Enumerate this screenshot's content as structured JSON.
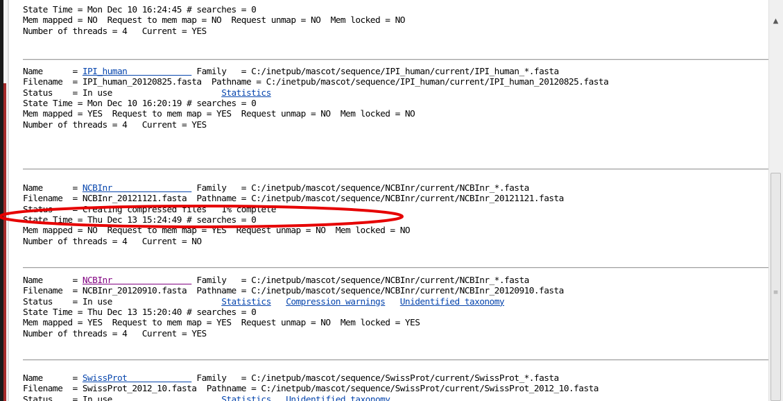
{
  "blocks": [
    {
      "id": "top",
      "lines": [
        [
          {
            "t": "State Time = Mon Dec 10 16:24:45 # searches = 0"
          }
        ],
        [
          {
            "t": "Mem mapped = NO  Request to mem map = NO  Request unmap = NO  Mem locked = NO"
          }
        ],
        [
          {
            "t": "Number of threads = 4   Current = YES"
          }
        ]
      ]
    },
    {
      "id": "ipi-human",
      "lines": [
        [
          {
            "t": "Name      = "
          },
          {
            "t": "IPI_human             ",
            "link": "link"
          },
          {
            "t": " Family   = C:/inetpub/mascot/sequence/IPI_human/current/IPI_human_*.fasta"
          }
        ],
        [
          {
            "t": "Filename  = IPI_human_20120825.fasta  Pathname = C:/inetpub/mascot/sequence/IPI_human/current/IPI_human_20120825.fasta"
          }
        ],
        [
          {
            "t": "Status    = In use                      "
          },
          {
            "t": "Statistics",
            "link": "link"
          }
        ],
        [
          {
            "t": "State Time = Mon Dec 10 16:20:19 # searches = 0"
          }
        ],
        [
          {
            "t": "Mem mapped = YES  Request to mem map = YES  Request unmap = NO  Mem locked = NO"
          }
        ],
        [
          {
            "t": "Number of threads = 4   Current = YES"
          }
        ]
      ]
    },
    {
      "id": "ncbinr-new",
      "lines": [
        [
          {
            "t": "Name      = "
          },
          {
            "t": "NCBInr                ",
            "link": "link"
          },
          {
            "t": " Family   = C:/inetpub/mascot/sequence/NCBInr/current/NCBInr_*.fasta"
          }
        ],
        [
          {
            "t": "Filename  = NCBInr_20121121.fasta  Pathname = C:/inetpub/mascot/sequence/NCBInr/current/NCBInr_20121121.fasta"
          }
        ],
        [
          {
            "t": "Status    = Creating compressed files   1% complete"
          }
        ],
        [
          {
            "t": "State Time = Thu Dec 13 15:24:49 # searches = 0"
          }
        ],
        [
          {
            "t": "Mem mapped = NO  Request to mem map = YES  Request unmap = NO  Mem locked = NO"
          }
        ],
        [
          {
            "t": "Number of threads = 4   Current = NO"
          }
        ]
      ]
    },
    {
      "id": "ncbinr-current",
      "lines": [
        [
          {
            "t": "Name      = "
          },
          {
            "t": "NCBInr                ",
            "link": "vlink"
          },
          {
            "t": " Family   = C:/inetpub/mascot/sequence/NCBInr/current/NCBInr_*.fasta"
          }
        ],
        [
          {
            "t": "Filename  = NCBInr_20120910.fasta  Pathname = C:/inetpub/mascot/sequence/NCBInr/current/NCBInr_20120910.fasta"
          }
        ],
        [
          {
            "t": "Status    = In use                      "
          },
          {
            "t": "Statistics",
            "link": "link"
          },
          {
            "t": "   "
          },
          {
            "t": "Compression warnings",
            "link": "link"
          },
          {
            "t": "   "
          },
          {
            "t": "Unidentified taxonomy",
            "link": "link"
          }
        ],
        [
          {
            "t": "State Time = Thu Dec 13 15:20:40 # searches = 0"
          }
        ],
        [
          {
            "t": "Mem mapped = YES  Request to mem map = YES  Request unmap = NO  Mem locked = YES"
          }
        ],
        [
          {
            "t": "Number of threads = 4   Current = YES"
          }
        ]
      ]
    },
    {
      "id": "swissprot",
      "lines": [
        [
          {
            "t": "Name      = "
          },
          {
            "t": "SwissProt             ",
            "link": "link"
          },
          {
            "t": " Family   = C:/inetpub/mascot/sequence/SwissProt/current/SwissProt_*.fasta"
          }
        ],
        [
          {
            "t": "Filename  = SwissProt_2012_10.fasta  Pathname = C:/inetpub/mascot/sequence/SwissProt/current/SwissProt_2012_10.fasta"
          }
        ],
        [
          {
            "t": "Status    = In use                      "
          },
          {
            "t": "Statistics",
            "link": "link"
          },
          {
            "t": "   "
          },
          {
            "t": "Unidentified taxonomy",
            "link": "link"
          }
        ]
      ]
    }
  ],
  "colors": {
    "link": "#0645ad",
    "visited": "#800080",
    "annotation": "#e60000"
  },
  "icons": {
    "scroll_up": "triangle-up-icon",
    "scroll_grip": "grip-icon"
  }
}
